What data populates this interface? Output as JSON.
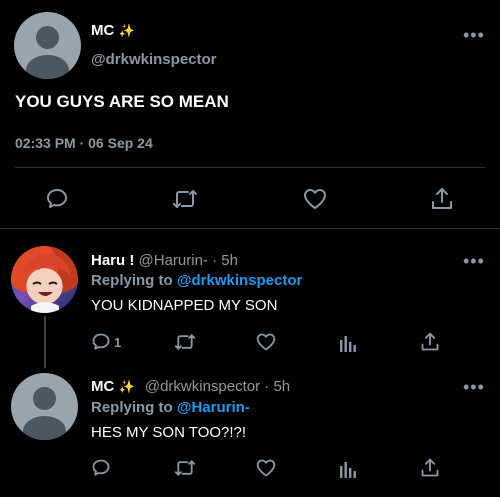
{
  "main_tweet": {
    "author_name": "MC",
    "author_emoji": "✨",
    "handle": "@drkwkinspector",
    "text": "YOU GUYS ARE SO MEAN",
    "timestamp": "02:33 PM · 06 Sep 24",
    "more_icon": "more-horizontal-icon"
  },
  "replies": [
    {
      "author_name": "Haru !",
      "handle": "@Harurin-",
      "time": "· 5h",
      "replying_label": "Replying to",
      "replying_to": "@drkwkinspector",
      "text": "YOU KIDNAPPED MY SON",
      "reply_count": "1"
    },
    {
      "author_name": "MC",
      "author_emoji": "✨",
      "handle": "@drkwkinspector",
      "time": "· 5h",
      "replying_label": "Replying to",
      "replying_to": "@Harurin-",
      "text": "HES MY SON TOO?!?!",
      "reply_count": ""
    }
  ],
  "colors": {
    "background": "#000000",
    "accent": "#1d9bf0",
    "muted": "#8b98a5",
    "text": "#e7e9ea"
  }
}
